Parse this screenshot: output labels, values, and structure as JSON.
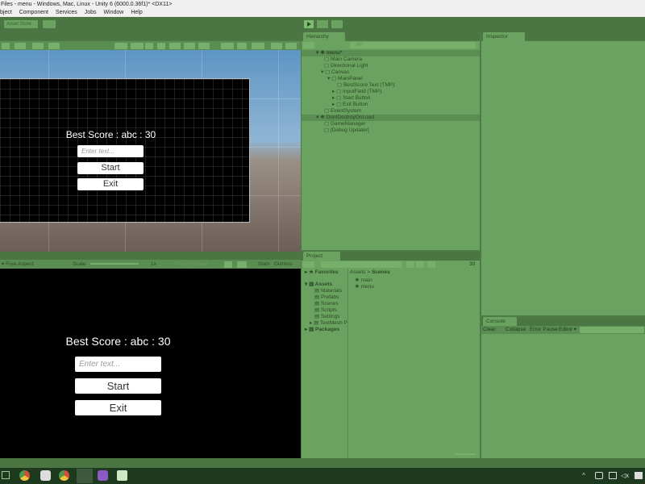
{
  "window": {
    "title": "Files - menu - Windows, Mac, Linux - Unity 6 (6000.0.36f1)* <DX11>"
  },
  "menubar": {
    "items": [
      "bject",
      "Component",
      "Services",
      "Jobs",
      "Window",
      "Help"
    ]
  },
  "scene_panel": {
    "tab_label": "Asset Store",
    "ui": {
      "title": "Best Score : abc : 30",
      "input_placeholder": "Enter text...",
      "start_label": "Start",
      "exit_label": "Exit"
    }
  },
  "game_panel": {
    "aspect_label": "Free Aspect",
    "scale_label": "Scale",
    "scale_value": "1x",
    "play_focused_label": "Play Focused",
    "stats_label": "Stats",
    "gizmos_label": "Gizmos",
    "ui": {
      "title": "Best Score : abc : 30",
      "input_placeholder": "Enter text...",
      "start_label": "Start",
      "exit_label": "Exit"
    }
  },
  "hierarchy": {
    "tab_label": "Hierarchy",
    "search_placeholder": "All",
    "items": [
      {
        "label": "menu*",
        "bold": true
      },
      {
        "label": "Main Camera"
      },
      {
        "label": "Directional Light"
      },
      {
        "label": "Canvas"
      },
      {
        "label": "MainPanel"
      },
      {
        "label": "BestScore Text (TMP)"
      },
      {
        "label": "InputField (TMP)"
      },
      {
        "label": "Start Button"
      },
      {
        "label": "Exit Button"
      },
      {
        "label": "EventSystem"
      },
      {
        "label": "DontDestroyOnLoad"
      },
      {
        "label": "GameManager"
      },
      {
        "label": "[Debug Updater]"
      }
    ]
  },
  "inspector": {
    "tab_label": "Inspector"
  },
  "project": {
    "tab_label": "Project",
    "count_label": "30",
    "favorites_label": "Favorites",
    "assets_label": "Assets",
    "packages_label": "Packages",
    "folders": [
      "Materials",
      "Prefabs",
      "Scenes",
      "Scripts",
      "Settings",
      "TextMesh P"
    ],
    "breadcrumb_root": "Assets",
    "breadcrumb_sep": ">",
    "breadcrumb_current": "Scenes",
    "files": [
      "main",
      "menu"
    ]
  },
  "console": {
    "tab_label": "Console",
    "clear_label": "Clear",
    "collapse_label": "Collapse",
    "error_pause_label": "Error Pause",
    "editor_label": "Editor"
  },
  "colors": {
    "panel": "#6aa35f",
    "panel_dark": "#4c7544",
    "game_bg": "#000000"
  }
}
